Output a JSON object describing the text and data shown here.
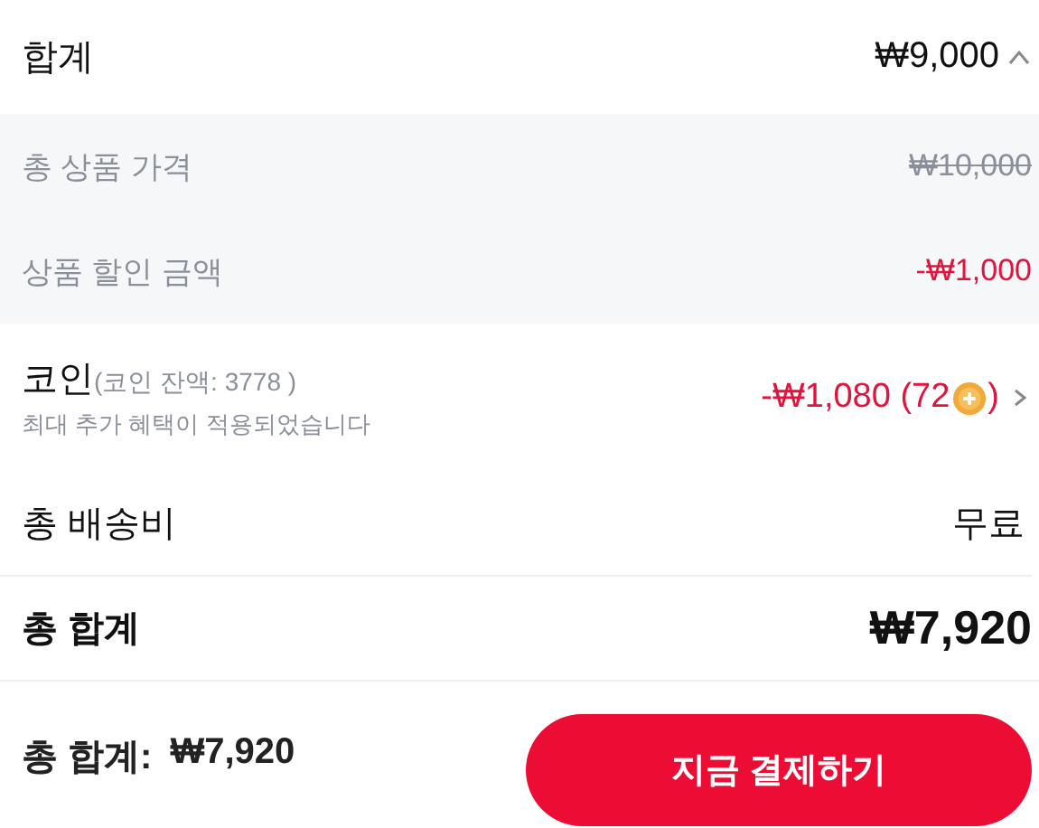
{
  "subtotal": {
    "label": "합계",
    "value": "₩9,000",
    "expanded": true
  },
  "breakdown": [
    {
      "label": "총 상품 가격",
      "value": "₩10,000",
      "kind": "original"
    },
    {
      "label": "상품 할인 금액",
      "value": "-₩1,000",
      "kind": "discount"
    }
  ],
  "coins": {
    "label": "코인",
    "balance": "(코인 잔액: 3778 )",
    "note": "최대 추가 혜택이 적용되었습니다",
    "value": "-₩1,080 (72",
    "value_end": ")"
  },
  "shipping": {
    "label": "총 배송비",
    "value": "무료"
  },
  "total": {
    "label": "총 합계",
    "value": "₩7,920"
  },
  "footer": {
    "label": "총 합계:",
    "value": "₩7,920",
    "button": "지금 결제하기"
  }
}
